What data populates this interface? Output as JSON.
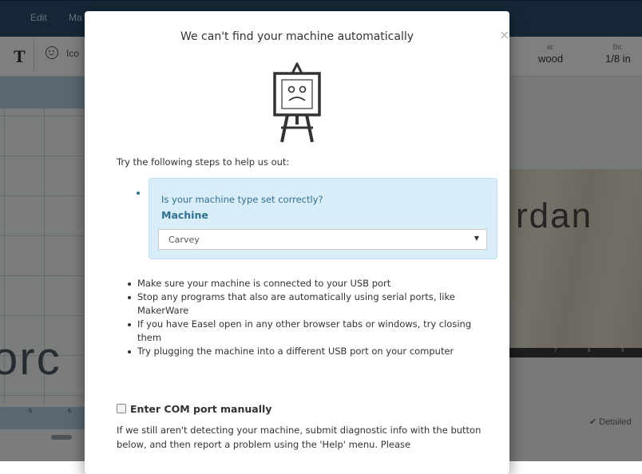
{
  "app": {
    "menu": {
      "edit": "Edit",
      "ma": "Ma"
    },
    "toolbar": {
      "text_tool": "T",
      "icons_label": "Ico",
      "material_key": "al:",
      "material_value": "wood",
      "bit_key": "Bit:",
      "bit_value": "1/8 in"
    },
    "left_big_text": "orc",
    "left_ruler": [
      "5",
      "6"
    ],
    "wood_text": "rdan",
    "wood_ruler": [
      "7",
      "8",
      "9"
    ],
    "detailed": "Detailed"
  },
  "modal": {
    "title": "We can't find your machine automatically",
    "close": "×",
    "icon": "sad-easel-icon",
    "intro": "Try the following steps to help us out:",
    "hint": {
      "question": "Is your machine type set correctly?",
      "label": "Machine",
      "selected": "Carvey"
    },
    "steps": [
      "Make sure your machine is connected to your USB port",
      "Stop any programs that also are automatically using serial ports, like MakerWare",
      "If you have Easel open in any other browser tabs or windows, try closing them",
      "Try plugging the machine into a different USB port on your computer"
    ],
    "manual_label": "Enter COM port manually",
    "note": "If we still aren't detecting your machine, submit diagnostic info with the button below, and then report a problem using the 'Help' menu. Please"
  },
  "colors": {
    "topbar": "#2a4e6e",
    "hint_background": "#d8edf7",
    "hint_text": "#31708f",
    "overlay": "rgba(0,0,0,0.5)"
  }
}
